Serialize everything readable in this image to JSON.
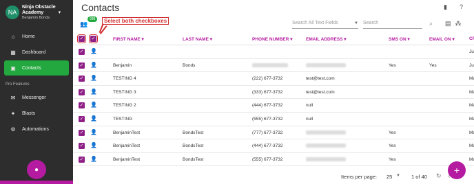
{
  "brand": {
    "initials": "NA",
    "name_line1": "Ninja Obstacle",
    "name_line2": "Academy",
    "user": "Benjamin Bonds"
  },
  "nav": [
    {
      "label": "Home",
      "icon": "home-icon",
      "glyph": "⌂"
    },
    {
      "label": "Dashboard",
      "icon": "dashboard-icon",
      "glyph": "▦"
    },
    {
      "label": "Contacts",
      "icon": "contacts-icon",
      "glyph": "▣",
      "active": true
    }
  ],
  "pro_section": "Pro Features",
  "pro_nav": [
    {
      "label": "Messenger",
      "icon": "messenger-icon",
      "glyph": "✉"
    },
    {
      "label": "Blasts",
      "icon": "blasts-icon",
      "glyph": "📢"
    },
    {
      "label": "Automations",
      "icon": "automations-icon",
      "glyph": "⚙"
    }
  ],
  "page_title": "Contacts",
  "toolbar": {
    "count_badge": "998",
    "annotation": "Select both checkboxes",
    "search_all_placeholder": "Search All Text Fields",
    "search_placeholder": "Search"
  },
  "columns": [
    "FIRST NAME",
    "LAST NAME",
    "PHONE NUMBER",
    "EMAIL ADDRESS",
    "SMS ON",
    "EMAIL ON",
    "CR"
  ],
  "rows": [
    {
      "first": "",
      "last": "",
      "phone": "",
      "email": "",
      "sms": "",
      "email_on": "",
      "cr": "Ju",
      "phone_blur": false,
      "email_blur": false
    },
    {
      "first": "Benjamin",
      "last": "Bonds",
      "phone": "",
      "email": "",
      "sms": "Yes",
      "email_on": "Yes",
      "cr": "Ju",
      "phone_blur": true,
      "email_blur": true
    },
    {
      "first": "TESTING 4",
      "last": "",
      "phone": "(222) 677-3732",
      "email": "test@test.com",
      "sms": "",
      "email_on": "",
      "cr": "Ma",
      "phone_blur": false,
      "email_blur": false
    },
    {
      "first": "TESTING 3",
      "last": "",
      "phone": "(333) 677-3732",
      "email": "test@test.com",
      "sms": "",
      "email_on": "",
      "cr": "Ma",
      "phone_blur": false,
      "email_blur": false
    },
    {
      "first": "TESTING 2",
      "last": "",
      "phone": "(444) 677-3732",
      "email": "null",
      "sms": "",
      "email_on": "",
      "cr": "Ma",
      "phone_blur": false,
      "email_blur": false
    },
    {
      "first": "TESTING",
      "last": "",
      "phone": "(555) 677-3732",
      "email": "null",
      "sms": "",
      "email_on": "",
      "cr": "Ma",
      "phone_blur": false,
      "email_blur": false
    },
    {
      "first": "BenjaminTest",
      "last": "BondsTest",
      "phone": "(777) 677-3732",
      "email": "",
      "sms": "Yes",
      "email_on": "",
      "cr": "Ma",
      "phone_blur": false,
      "email_blur": true
    },
    {
      "first": "BenjaminTest",
      "last": "BondsTest",
      "phone": "(444) 677-3732",
      "email": "",
      "sms": "Yes",
      "email_on": "",
      "cr": "Ma",
      "phone_blur": false,
      "email_blur": true
    },
    {
      "first": "BenjaminTest",
      "last": "BondsTest",
      "phone": "(555) 677-3732",
      "email": "",
      "sms": "Yes",
      "email_on": "",
      "cr": "Ma",
      "phone_blur": false,
      "email_blur": true
    }
  ],
  "footer": {
    "items_label": "Items per page:",
    "page_size": "25",
    "range": "1 of 40"
  }
}
